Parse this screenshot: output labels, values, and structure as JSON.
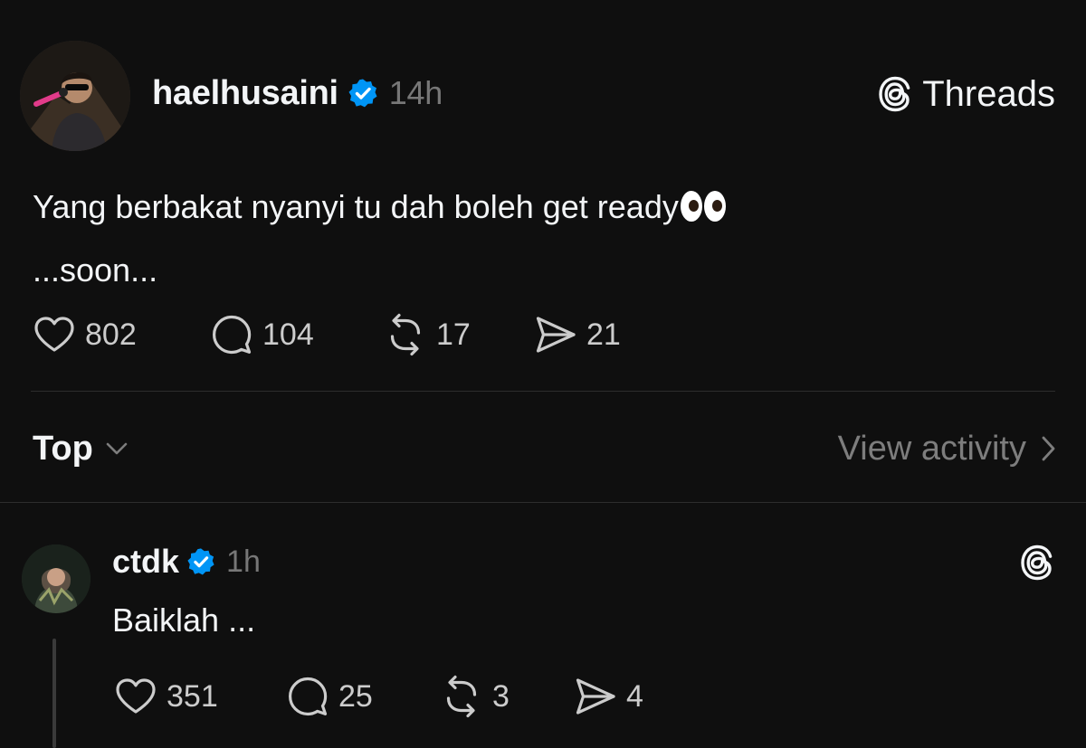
{
  "post": {
    "author": "haelhusaini",
    "time": "14h",
    "text_line1": "Yang berbakat nyanyi tu dah boleh get ready",
    "emoji": "👀",
    "text_line2": "...soon...",
    "likes": "802",
    "comments": "104",
    "reposts": "17",
    "shares": "21"
  },
  "brand": {
    "name": "Threads"
  },
  "sort": {
    "label": "Top",
    "view_activity": "View activity"
  },
  "reply": {
    "author": "ctdk",
    "time": "1h",
    "text": "Baiklah ...",
    "likes": "351",
    "comments": "25",
    "reposts": "3",
    "shares": "4"
  },
  "colors": {
    "background": "#0f0f0f",
    "text": "#f3f5f7",
    "muted": "#777777",
    "verified": "#0095f6",
    "divider": "#2d2d2d"
  }
}
